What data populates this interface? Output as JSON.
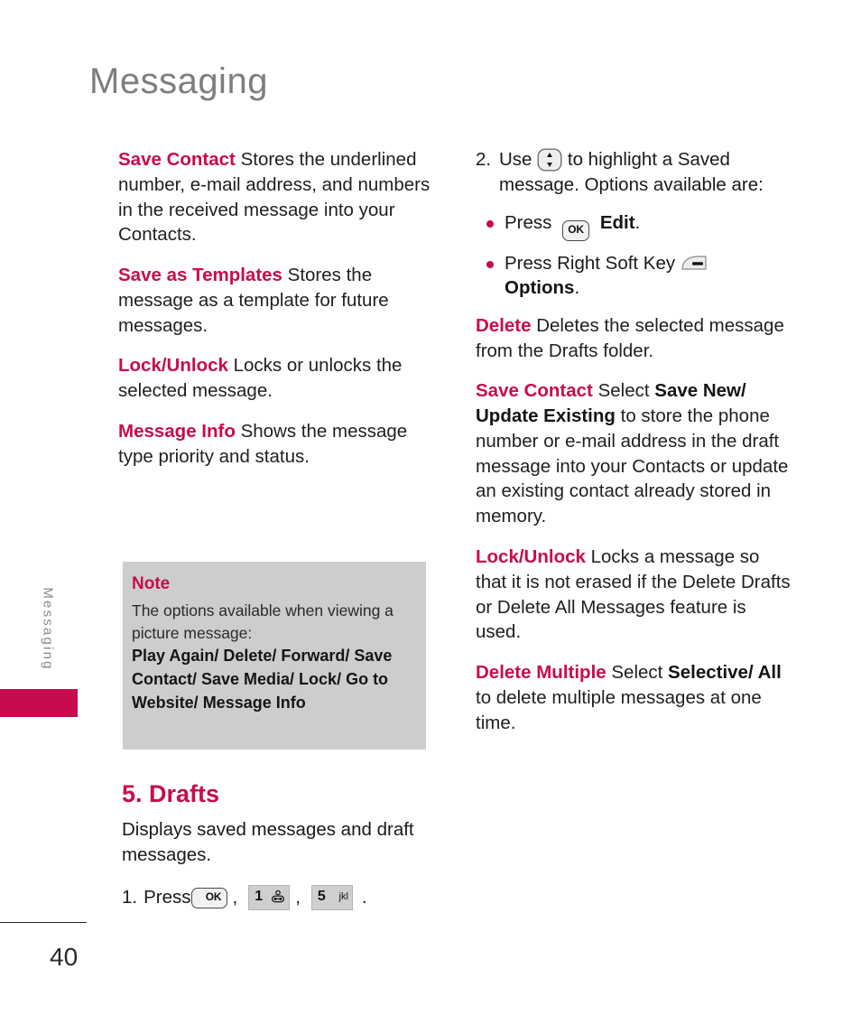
{
  "page": {
    "title": "Messaging",
    "side_tab_label": "Messaging",
    "page_number": "40",
    "accent_color": "#c80b4e",
    "title_color": "#7e7e7e",
    "note_bg_color": "#cdcdcd"
  },
  "left_column": {
    "paragraphs": [
      {
        "term": "Save Contact",
        "text": " Stores the underlined number, e-mail address, and numbers in the received message into your Contacts."
      },
      {
        "term": "Save as Templates",
        "text": " Stores the message as a template for future messages."
      },
      {
        "term": "Lock/Unlock",
        "text": " Locks or unlocks the selected message."
      },
      {
        "term": "Message Info",
        "text": " Shows the message type priority and status."
      }
    ]
  },
  "note": {
    "heading": "Note",
    "text": "The options available when viewing a picture message:",
    "options": "Play Again/ Delete/ Forward/ Save Contact/ Save Media/ Lock/ Go to Website/ Message Info"
  },
  "drafts": {
    "heading": "5. Drafts",
    "description": "Displays saved messages and draft messages.",
    "step_number": "1.",
    "step_verb": "Press",
    "keys": [
      {
        "icon": "ok-key-icon",
        "label": "OK"
      },
      {
        "icon": "number-key-1-icon",
        "digit": "1",
        "sub": "voicemail"
      },
      {
        "icon": "number-key-5-icon",
        "digit": "5",
        "sub": "jkl"
      }
    ],
    "comma": ",",
    "period": "."
  },
  "right_column": {
    "step": {
      "number": "2.",
      "text_before": "Use",
      "key_icon": "navigation-key-icon",
      "text_after": "to highlight a Saved message. Options available are:"
    },
    "bullets": [
      {
        "text_before": "Press",
        "key_icon": "ok-key-icon",
        "key_label": "OK",
        "bold_after": "Edit",
        "text_end": "."
      },
      {
        "text_before": "Press Right Soft Key",
        "key_icon": "right-soft-key-icon",
        "bold_after": "Options",
        "text_end": "."
      }
    ],
    "paragraphs": [
      {
        "term": "Delete",
        "text": " Deletes the selected message from the Drafts folder."
      },
      {
        "term": "Save Contact",
        "text_1": " Select ",
        "bold_1": "Save New/ Update Existing",
        "text_2": " to store the phone number or e-mail address in the draft message into your Contacts or update an existing contact already stored in memory."
      },
      {
        "term": "Lock/Unlock",
        "text": " Locks a message so that it is not erased if the Delete Drafts or Delete All Messages feature is used."
      },
      {
        "term": "Delete Multiple",
        "text_1": "  Select ",
        "bold_1": "Selective/ All",
        "text_2": " to delete multiple messages at one time."
      }
    ]
  }
}
